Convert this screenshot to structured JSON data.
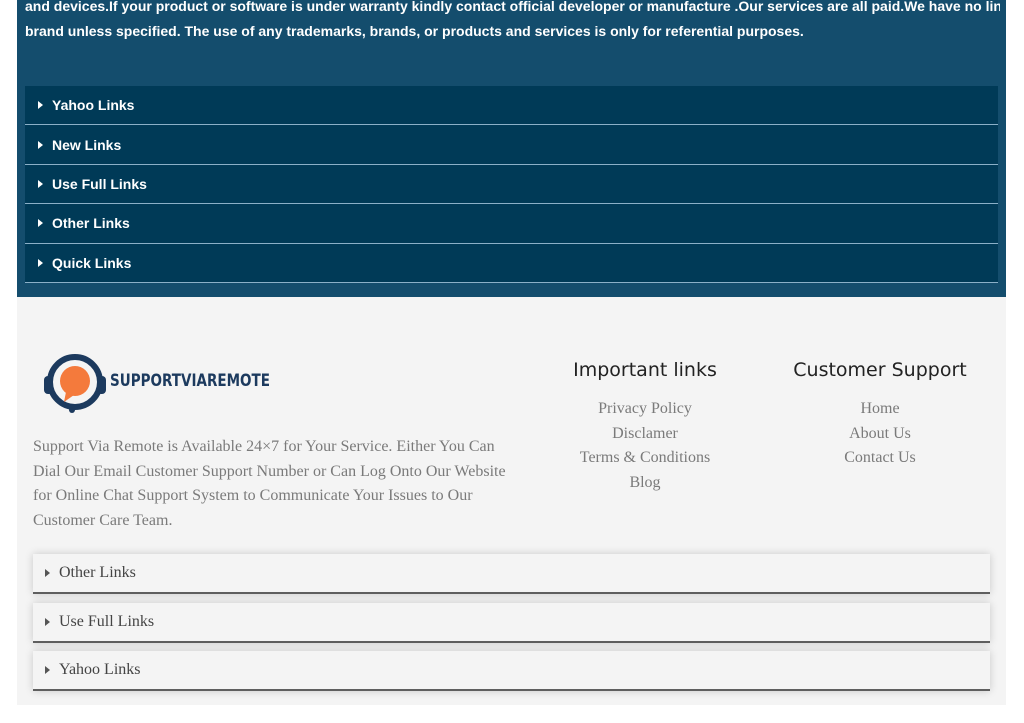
{
  "disclaimer": {
    "line1": "and devices.If your product or software is under warranty kindly contact official developer or manufacture .Our services are all paid.We have no links with any",
    "line2": "brand unless specified. The use of any trademarks, brands, or products and services is only for referential purposes."
  },
  "top_accordion": [
    {
      "label": "Yahoo Links"
    },
    {
      "label": "New Links"
    },
    {
      "label": "Use Full Links"
    },
    {
      "label": "Other Links"
    },
    {
      "label": "Quick Links"
    }
  ],
  "logo": {
    "text": "SUPPORTVIAREMOTE",
    "colors": {
      "ring": "#1c3a5e",
      "bubble": "#f47a3c",
      "text": "#1c3a5e"
    }
  },
  "about_text": "Support Via Remote is Available 24×7 for Your Service. Either You Can Dial Our Email Customer Support Number or Can Log Onto Our Website for Online Chat Support System to Communicate Your Issues to Our Customer Care Team.",
  "important_links": {
    "title": "Important links",
    "items": [
      "Privacy Policy",
      "Disclamer",
      "Terms & Conditions",
      "Blog"
    ]
  },
  "customer_support": {
    "title": "Customer Support",
    "items": [
      "Home",
      "About Us",
      "Contact Us"
    ]
  },
  "bottom_accordion": [
    {
      "label": "Other Links"
    },
    {
      "label": "Use Full Links"
    },
    {
      "label": "Yahoo Links"
    }
  ],
  "colors": {
    "top_band": "#144d6d",
    "accordion_bg": "#003a57",
    "footer_bg": "#f4f4f4"
  }
}
